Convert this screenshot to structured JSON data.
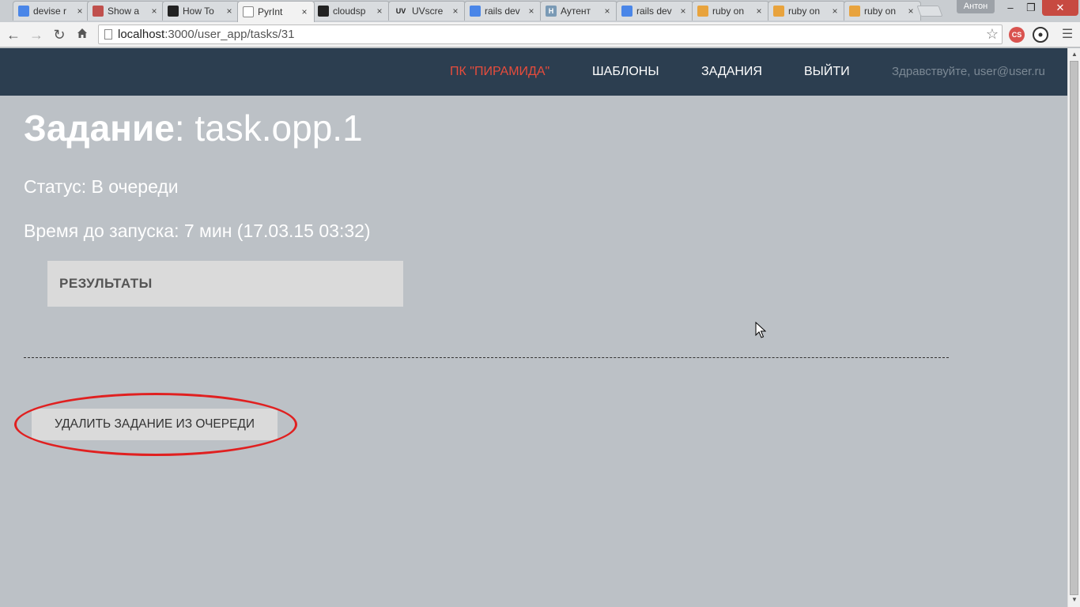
{
  "browser": {
    "tabs": [
      {
        "title": "devise r",
        "icon": "google-icon"
      },
      {
        "title": "Show a",
        "icon": "photo-icon"
      },
      {
        "title": "How To",
        "icon": "github-icon"
      },
      {
        "title": "PyrInt",
        "icon": "page-icon",
        "active": true
      },
      {
        "title": "cloudsp",
        "icon": "github-icon"
      },
      {
        "title": "UVscre",
        "icon": "uv-icon",
        "icon_text": "UV"
      },
      {
        "title": "rails dev",
        "icon": "google-icon"
      },
      {
        "title": "Аутент",
        "icon": "habr-icon",
        "icon_text": "H"
      },
      {
        "title": "rails dev",
        "icon": "google-icon"
      },
      {
        "title": "ruby on",
        "icon": "stackoverflow-icon"
      },
      {
        "title": "ruby on",
        "icon": "stackoverflow-icon"
      },
      {
        "title": "ruby on",
        "icon": "stackoverflow-icon"
      }
    ],
    "close_glyph": "×",
    "profile_name": "Антон",
    "url_host": "localhost",
    "url_path": ":3000/user_app/tasks/31"
  },
  "nav": {
    "brand": "ПК \"ПИРАМИДА\"",
    "templates": "ШАБЛОНЫ",
    "tasks": "ЗАДАНИЯ",
    "logout": "ВЫЙТИ",
    "greeting": "Здравствуйте, user@user.ru"
  },
  "task": {
    "title_label": "Задание",
    "title_sep": ":",
    "title_name": "task.opp.1",
    "status_line": "Статус: В очереди",
    "time_line": "Время до запуска: 7 мин (17.03.15 03:32)",
    "results_label": "РЕЗУЛЬТАТЫ",
    "remove_button": "УДАЛИТЬ ЗАДАНИЕ ИЗ ОЧЕРЕДИ"
  },
  "colors": {
    "navbar_bg": "#2c3e50",
    "brand": "#e74c3c",
    "page_bg": "#bcc1c6",
    "highlight_ring": "#e02020"
  }
}
